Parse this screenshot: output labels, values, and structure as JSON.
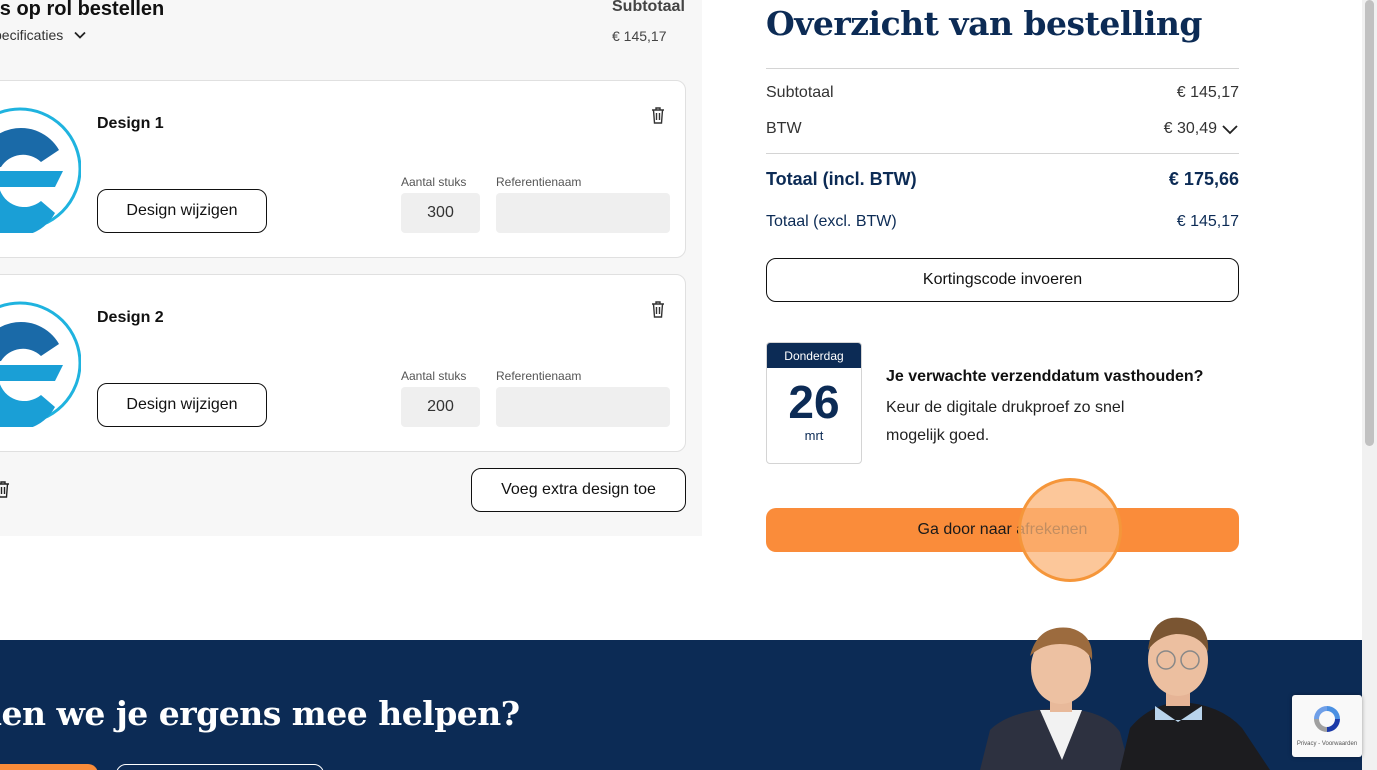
{
  "cart": {
    "product_title": "rs op rol bestellen",
    "specs_toggle": "pecificaties",
    "subtotal_header": "Subtotaal",
    "subtotal_value": "€ 145,17",
    "designs": [
      {
        "name": "Design 1",
        "edit_label": "Design wijzigen",
        "qty_label": "Aantal stuks",
        "qty_value": "300",
        "ref_label": "Referentienaam",
        "ref_value": ""
      },
      {
        "name": "Design 2",
        "edit_label": "Design wijzigen",
        "qty_label": "Aantal stuks",
        "qty_value": "200",
        "ref_label": "Referentienaam",
        "ref_value": ""
      }
    ],
    "add_design_label": "Voeg extra design toe"
  },
  "summary": {
    "title": "Overzicht van bestelling",
    "subtotal_label": "Subtotaal",
    "subtotal_value": "€ 145,17",
    "btw_label": "BTW",
    "btw_value": "€ 30,49",
    "total_incl_label": "Totaal (incl. BTW)",
    "total_incl_value": "€ 175,66",
    "total_excl_label": "Totaal (excl. BTW)",
    "total_excl_value": "€ 145,17",
    "discount_label": "Kortingscode invoeren",
    "calendar": {
      "weekday": "Donderdag",
      "day": "26",
      "month": "mrt"
    },
    "ship_title": "Je verwachte verzenddatum vasthouden?",
    "ship_text": "Keur de digitale drukproef zo snel mogelijk goed.",
    "checkout_label": "Ga door naar afrekenen"
  },
  "help": {
    "title": "nen we je ergens mee helpen?"
  },
  "recaptcha": {
    "text": "Privacy - Voorwaarden"
  },
  "colors": {
    "navy": "#0c2b55",
    "orange": "#fa8c3a",
    "panel_bg": "#f7f7f7",
    "logo_blue": "#1a9fd6"
  }
}
